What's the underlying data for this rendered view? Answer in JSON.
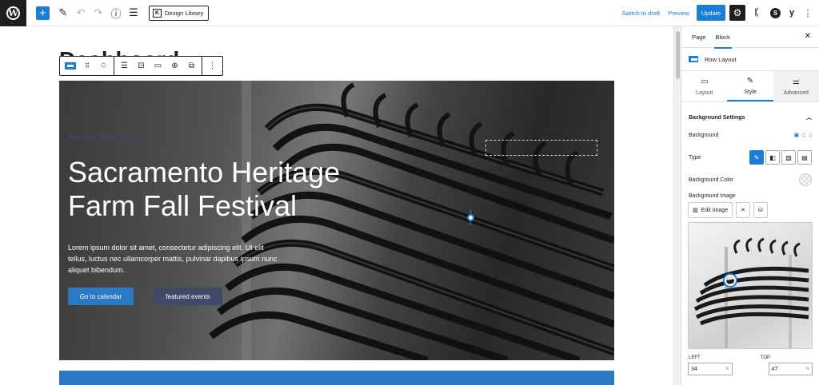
{
  "topbar": {
    "design_library_label": "Design Library",
    "switch_to_draft_label": "Switch to draft",
    "preview_label": "Preview",
    "update_label": "Update"
  },
  "editor": {
    "page_title": "Dashboard"
  },
  "hero": {
    "eyebrow": "Welcome To Our Festival",
    "title": "Sacramento Heritage Farm Fall Festival",
    "body": "Lorem ipsum dolor sit amet, consectetur adipiscing elit. Ut elit tellus, luctus nec ullamcorper mattis, pulvinar dapibus ipsum nunc aliquet bibendum.",
    "primary_button": "Go to calendar",
    "secondary_button": "featured events"
  },
  "sidebar": {
    "tabs": [
      "Page",
      "Block"
    ],
    "block_name": "Row Layout",
    "panel_tabs": [
      "Layout",
      "Style",
      "Advanced"
    ],
    "section_title": "Background Settings",
    "background_label": "Background",
    "type_label": "Type",
    "bg_color_label": "Background Color",
    "bg_image_label": "Background Image",
    "edit_image_label": "Edit Image",
    "left_label": "LEFT",
    "top_label": "TOP",
    "left_value": "34",
    "top_value": "47",
    "unit": "%"
  },
  "colors": {
    "accent": "#1a7dd6",
    "hero_primary_button": "#2b78c5",
    "hero_secondary_button": "#3f4a68"
  }
}
